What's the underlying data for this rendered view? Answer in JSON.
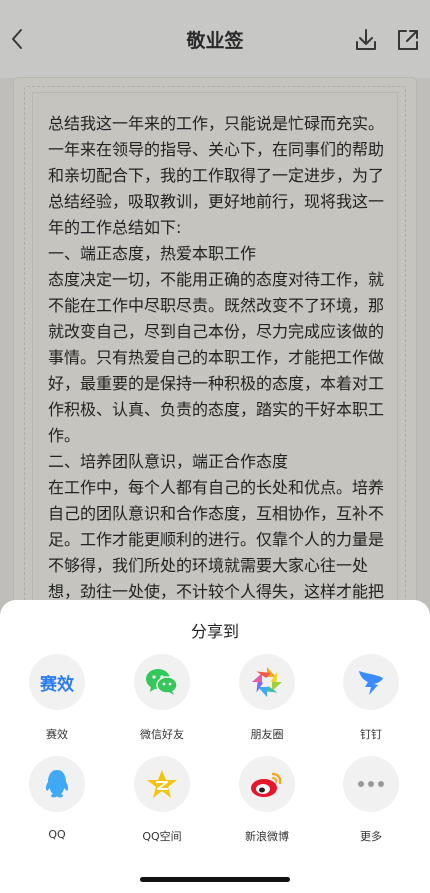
{
  "header": {
    "title": "敬业签"
  },
  "document": {
    "text": "总结我这一年来的工作，只能说是忙碌而充实。一年来在领导的指导、关心下，在同事们的帮助和亲切配合下，我的工作取得了一定进步，为了总结经验，吸取教训，更好地前行，现将我这一年的工作总结如下:\n一、端正态度，热爱本职工作\n态度决定一切，不能用正确的态度对待工作，就不能在工作中尽职尽责。既然改变不了环境，那就改变自己，尽到自己本份，尽力完成应该做的事情。只有热爱自己的本职工作，才能把工作做好，最重要的是保持一种积极的态度，本着对工作积极、认真、负责的态度，踏实的干好本职工作。\n二、培养团队意识，端正合作态度\n在工作中，每个人都有自己的长处和优点。培养自己的团队意识和合作态度，互相协作，互补不足。工作才能更顺利的进行。仅靠个人的力量是不够得，我们所处的环境就需要大家心往一处想，劲往一处使，不计较个人得失，这样才能把工作圆满完成。"
  },
  "share_sheet": {
    "title": "分享到",
    "items": [
      {
        "label": "赛效",
        "icon": "saixiao-logo-icon",
        "logo_text": "赛效",
        "color": "#2b7cf3"
      },
      {
        "label": "微信好友",
        "icon": "wechat-icon",
        "color": "#34c759"
      },
      {
        "label": "朋友圈",
        "icon": "moments-icon",
        "color": "#f5a623"
      },
      {
        "label": "钉钉",
        "icon": "dingtalk-icon",
        "color": "#3b8cff"
      },
      {
        "label": "QQ",
        "icon": "qq-icon",
        "color": "#3fa9f5"
      },
      {
        "label": "QQ空间",
        "icon": "qzone-icon",
        "color": "#f6c40e"
      },
      {
        "label": "新浪微博",
        "icon": "weibo-icon",
        "color": "#e6162d"
      },
      {
        "label": "更多",
        "icon": "more-icon",
        "color": "#9a9a9a"
      }
    ]
  }
}
